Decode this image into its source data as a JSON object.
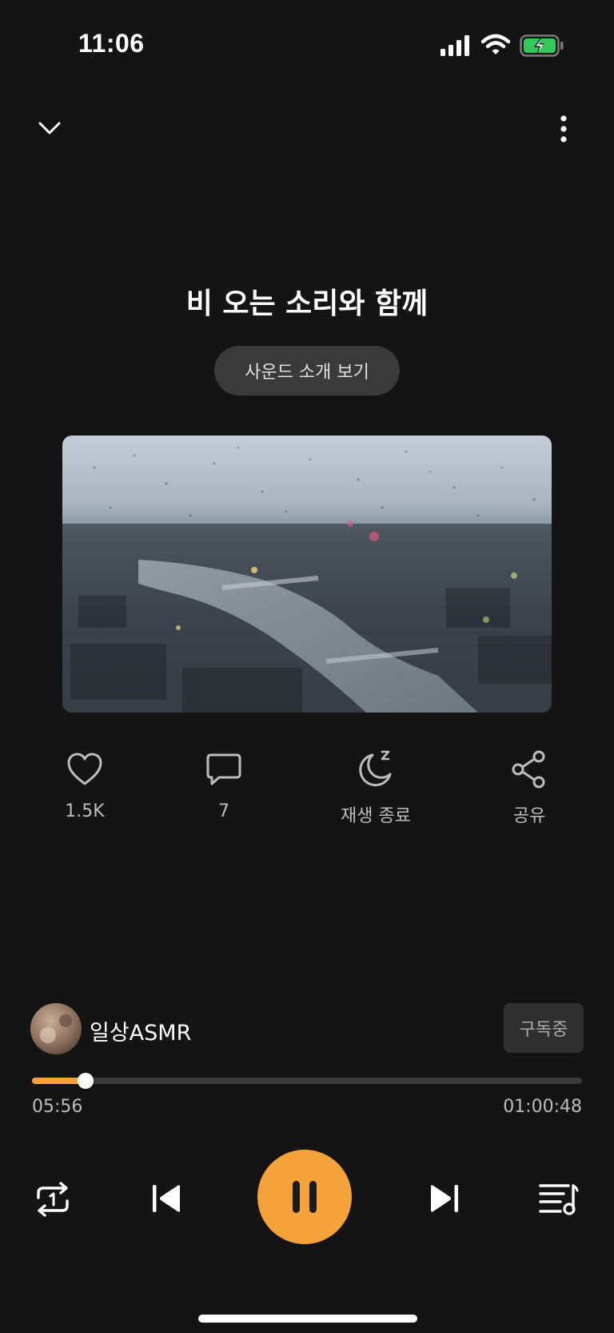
{
  "status_bar": {
    "time": "11:06",
    "icons": [
      "cellular-signal-icon",
      "wifi-icon",
      "battery-charging-icon"
    ],
    "battery_color": "#34c759"
  },
  "header": {
    "collapse_icon": "chevron-down-icon",
    "more_icon": "more-vertical-icon"
  },
  "track": {
    "title": "비 오는 소리와 함께",
    "intro_label": "사운드 소개 보기"
  },
  "actions": [
    {
      "icon": "heart-icon",
      "label": "1.5K"
    },
    {
      "icon": "comment-icon",
      "label": "7"
    },
    {
      "icon": "sleep-timer-icon",
      "label": "재생 종료"
    },
    {
      "icon": "share-icon",
      "label": "공유"
    }
  ],
  "channel": {
    "name": "일상ASMR",
    "subscribe_label": "구독중"
  },
  "progress": {
    "current": "05:56",
    "total": "01:00:48",
    "fraction": 0.098
  },
  "controls": {
    "repeat_icon": "repeat-one-icon",
    "prev_icon": "skip-previous-icon",
    "play_icon": "pause-icon",
    "next_icon": "skip-next-icon",
    "queue_icon": "playlist-icon"
  },
  "colors": {
    "accent": "#f5a23a",
    "background": "#141414",
    "secondary_text": "#bdbdbd"
  }
}
